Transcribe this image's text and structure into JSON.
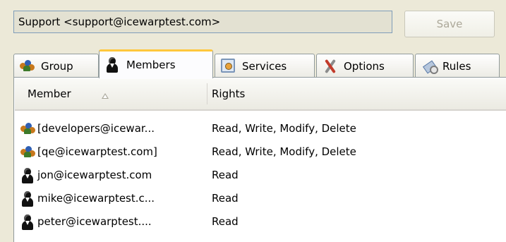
{
  "account": {
    "value": "Support <support@icewarptest.com>"
  },
  "toolbar": {
    "save_label": "Save"
  },
  "tabs": [
    {
      "label": "Group",
      "icon": "group-icon"
    },
    {
      "label": "Members",
      "icon": "person-icon",
      "active": true
    },
    {
      "label": "Services",
      "icon": "services-icon"
    },
    {
      "label": "Options",
      "icon": "options-icon"
    },
    {
      "label": "Rules",
      "icon": "rules-icon"
    }
  ],
  "members": {
    "columns": {
      "member": "Member",
      "rights": "Rights"
    },
    "rows": [
      {
        "member": "[developers@icewar...",
        "rights": "Read, Write, Modify, Delete",
        "icon": "group-icon"
      },
      {
        "member": "[qe@icewarptest.com]",
        "rights": "Read, Write, Modify, Delete",
        "icon": "group-icon"
      },
      {
        "member": "jon@icewarptest.com",
        "rights": "Read",
        "icon": "person-icon"
      },
      {
        "member": "mike@icewarptest.c...",
        "rights": "Read",
        "icon": "person-icon"
      },
      {
        "member": "peter@icewarptest....",
        "rights": "Read",
        "icon": "person-icon"
      }
    ]
  }
}
